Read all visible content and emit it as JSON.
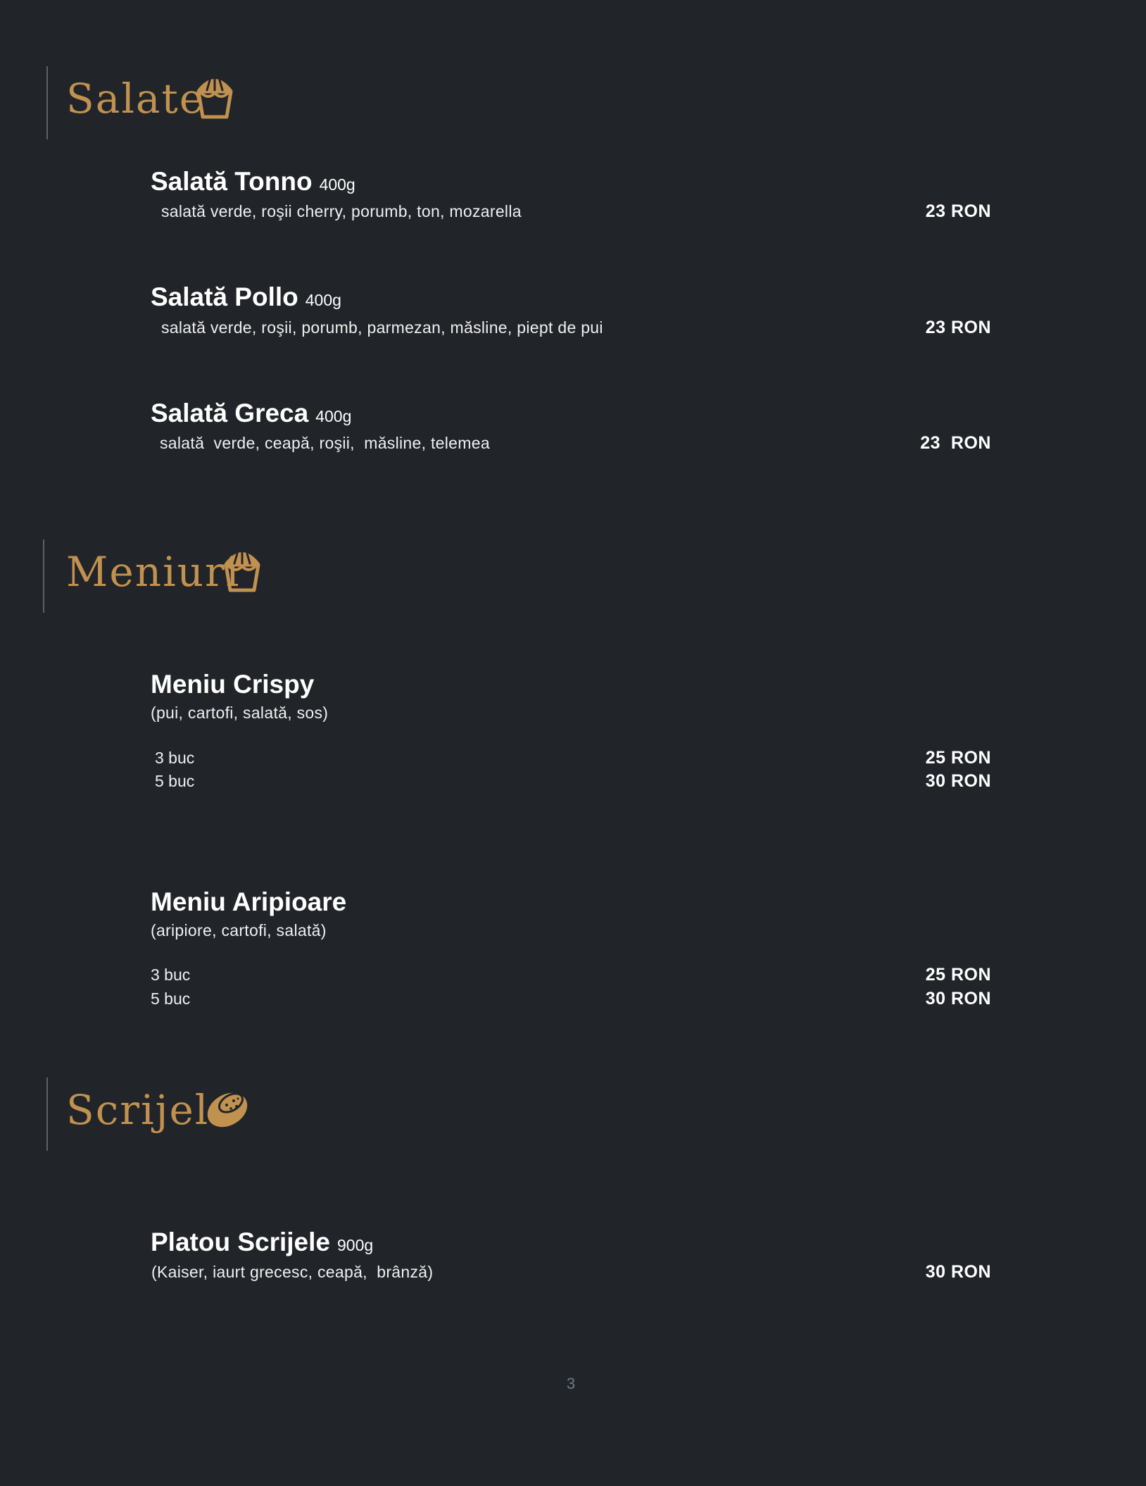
{
  "sections": {
    "salate": {
      "title": "Salate",
      "icon": "fries-icon",
      "items": [
        {
          "name": "Salată Tonno",
          "weight": "400g",
          "description": "salată verde, roşii cherry, porumb, ton, mozarella",
          "price": "23 RON"
        },
        {
          "name": "Salată Pollo",
          "weight": "400g",
          "description": "salată verde, roşii, porumb, parmezan, măsline, piept de pui",
          "price": "23 RON"
        },
        {
          "name": "Salată Greca",
          "weight": "400g",
          "description": "salată  verde, ceapă, roşii,  măsline, telemea",
          "price": "23  RON"
        }
      ]
    },
    "meniuri": {
      "title": "Meniuri",
      "icon": "fries-icon",
      "items": [
        {
          "name": "Meniu Crispy",
          "description": "(pui, cartofi, salată, sos)",
          "options": [
            {
              "qty": "3 buc",
              "price": "25 RON"
            },
            {
              "qty": "5 buc",
              "price": "30 RON"
            }
          ]
        },
        {
          "name": "Meniu Aripioare",
          "description": "(aripiore, cartofi, salată)",
          "options": [
            {
              "qty": "3 buc",
              "price": "25 RON"
            },
            {
              "qty": "5 buc",
              "price": "30 RON"
            }
          ]
        }
      ]
    },
    "scrijele": {
      "title": "Scrijele",
      "icon": "potato-icon",
      "items": [
        {
          "name": "Platou Scrijele",
          "weight": "900g",
          "description": "(Kaiser, iaurt grecesc, ceapă,  brânză)",
          "price": "30 RON"
        }
      ]
    }
  },
  "page_number": "3",
  "colors": {
    "background": "#212429",
    "accent_gold": "#c1914f",
    "text": "#ffffff",
    "divider": "#5a6268",
    "page_number": "#6e7b84"
  }
}
